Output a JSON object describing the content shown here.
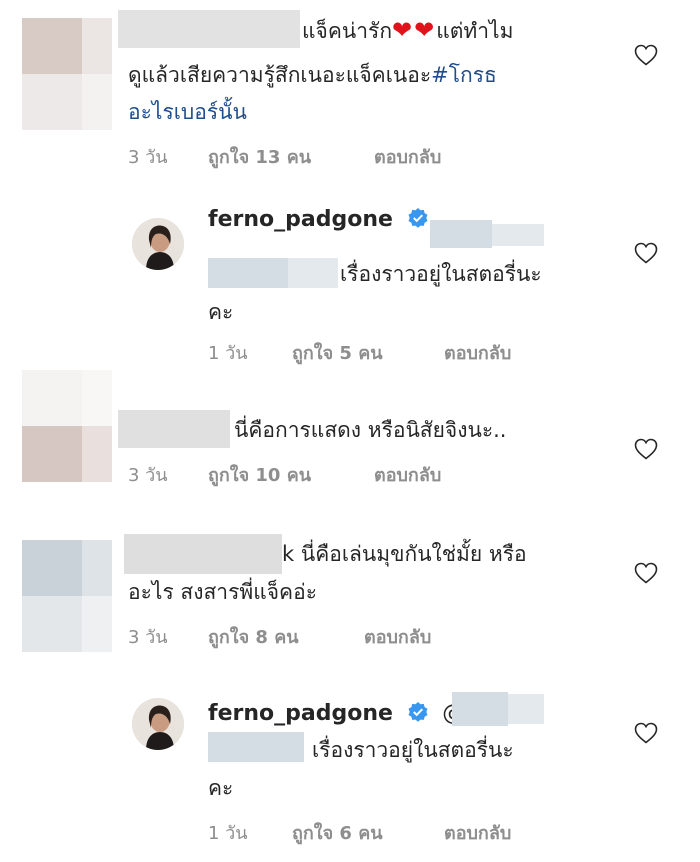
{
  "comments": [
    {
      "text_line1": "แจ็คน่ารัก",
      "text_line1b": "แต่ทำไม",
      "text_line1_emoji": "❤❤",
      "text_line2a": "ดูแล้วเสียความรู้สึกเนอะแจ็คเนอะ",
      "text_line2b": "#โกรธ",
      "text_line3": "อะไรเบอร์นั้น",
      "time": "3 วัน",
      "likes": "ถูกใจ 13 คน",
      "reply": "ตอบกลับ"
    },
    {
      "username": "ferno_padgone",
      "text_line1": "เรื่องราวอยู่ในสตอรี่นะ",
      "text_line2": "คะ",
      "time": "1 วัน",
      "likes": "ถูกใจ 5 คน",
      "reply": "ตอบกลับ"
    },
    {
      "text_line1": "นี่คือการแสดง หรือนิสัยจิงนะ..",
      "time": "3 วัน",
      "likes": "ถูกใจ 10 คน",
      "reply": "ตอบกลับ"
    },
    {
      "text_line1a": "k",
      "text_line1": "นี่คือเล่นมุขกันใช่มั้ย หรือ",
      "text_line2": "อะไร สงสารพี่แจ็คอ่ะ",
      "time": "3 วัน",
      "likes": "ถูกใจ 8 คน",
      "reply": "ตอบกลับ"
    },
    {
      "username": "ferno_padgone",
      "mention_prefix": "@",
      "text_line1": "เรื่องราวอยู่ในสตอรี่นะ",
      "text_line2": "คะ",
      "time": "1 วัน",
      "likes": "ถูกใจ 6 คน",
      "reply": "ตอบกลับ"
    }
  ],
  "colors": {
    "text": "#262626",
    "meta": "#8e8e8e",
    "verified": "#3897f0",
    "hashtag": "#1e4d8c",
    "heart": "#262626"
  },
  "icons": {
    "like": "heart-outline-icon",
    "verified": "verified-badge-icon"
  }
}
